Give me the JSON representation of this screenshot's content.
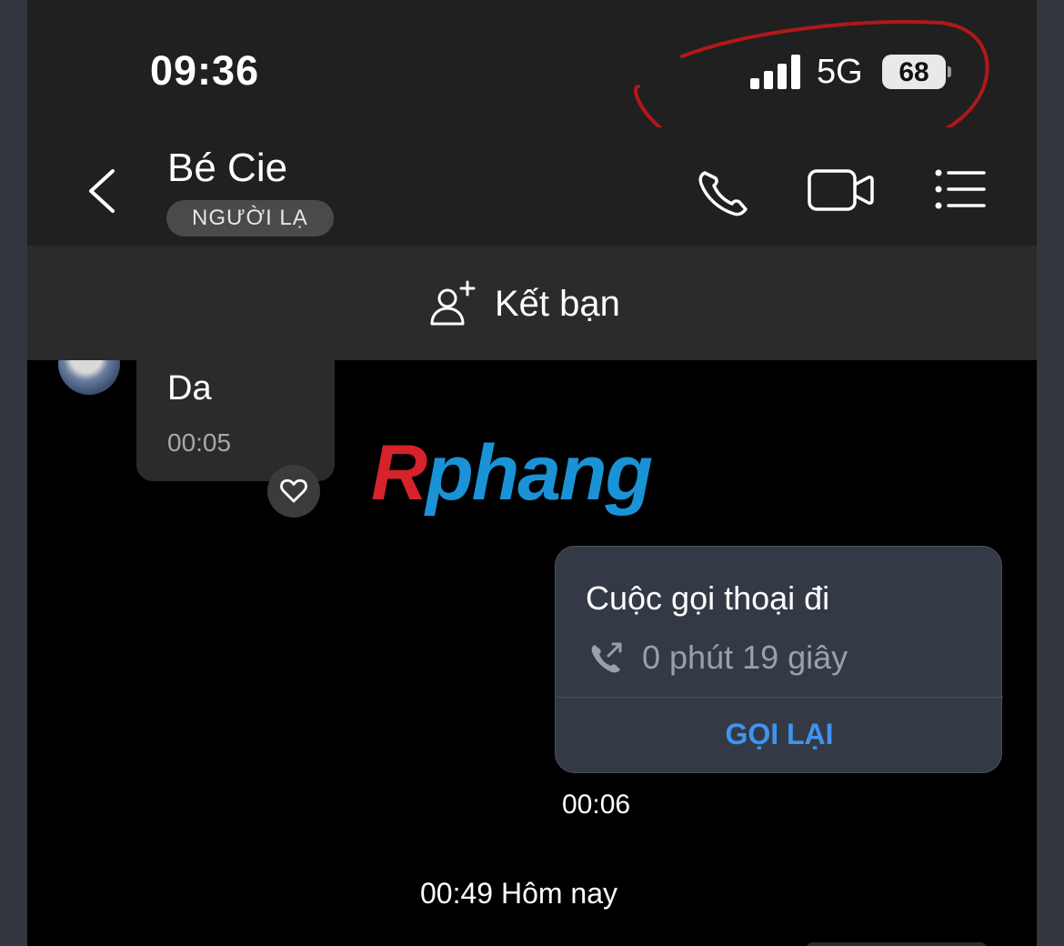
{
  "status_bar": {
    "time": "09:36",
    "network": "5G",
    "battery": "68",
    "signal_level": 4
  },
  "header": {
    "contact_name": "Bé Cie",
    "badge": "NGƯỜI LẠ",
    "icons": [
      "back-icon",
      "phone-icon",
      "video-camera-icon",
      "menu-list-icon"
    ]
  },
  "add_friend": {
    "label": "Kết bạn",
    "icon": "add-person-icon"
  },
  "messages": {
    "incoming": {
      "text": "Da",
      "time": "00:05"
    },
    "call_card": {
      "title": "Cuộc gọi thoại đi",
      "duration": "0 phút 19 giây",
      "action": "GỌI LẠI",
      "time": "00:06"
    },
    "date_separator": "00:49 Hôm nay"
  },
  "watermark": {
    "first": "R",
    "rest": "phang"
  },
  "colors": {
    "accent_blue": "#3f94f0",
    "annotation_red": "#b0181b",
    "watermark_red": "#d6222b",
    "watermark_blue": "#1a93d6"
  }
}
